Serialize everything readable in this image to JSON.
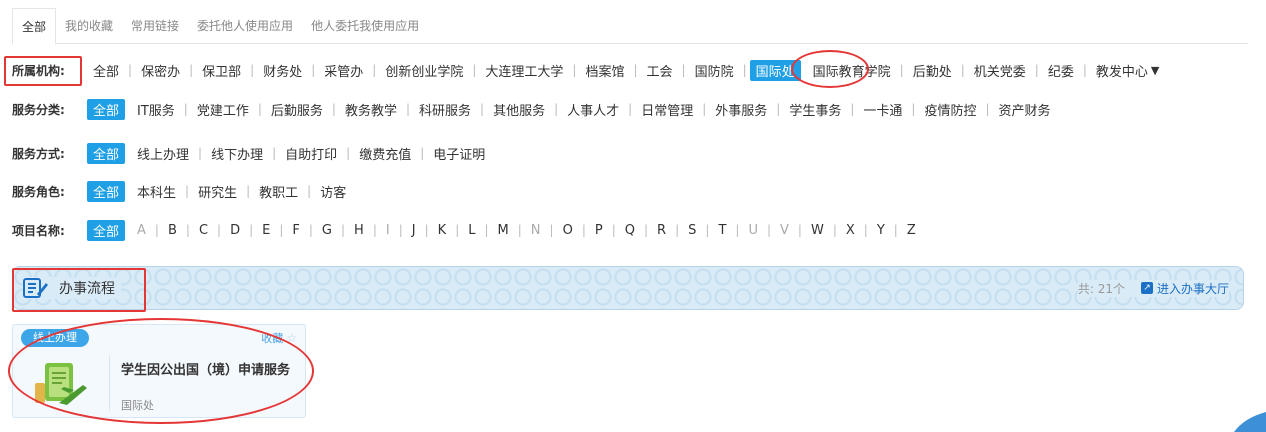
{
  "tabs": [
    "全部",
    "我的收藏",
    "常用链接",
    "委托他人使用应用",
    "他人委托我使用应用"
  ],
  "filters": {
    "org": {
      "label": "所属机构:",
      "items": [
        "全部",
        "保密办",
        "保卫部",
        "财务处",
        "采管办",
        "创新创业学院",
        "大连理工大学",
        "档案馆",
        "工会",
        "国防院",
        "国际处",
        "国际教育学院",
        "后勤处",
        "机关党委",
        "纪委",
        "教发中心"
      ],
      "selected": "国际处"
    },
    "category": {
      "label": "服务分类:",
      "items": [
        "全部",
        "IT服务",
        "党建工作",
        "后勤服务",
        "教务教学",
        "科研服务",
        "其他服务",
        "人事人才",
        "日常管理",
        "外事服务",
        "学生事务",
        "一卡通",
        "疫情防控",
        "资产财务"
      ],
      "selected": "全部"
    },
    "method": {
      "label": "服务方式:",
      "items": [
        "全部",
        "线上办理",
        "线下办理",
        "自助打印",
        "缴费充值",
        "电子证明"
      ],
      "selected": "全部"
    },
    "role": {
      "label": "服务角色:",
      "items": [
        "全部",
        "本科生",
        "研究生",
        "教职工",
        "访客"
      ],
      "selected": "全部"
    },
    "name": {
      "label": "项目名称:",
      "items": [
        "全部",
        "A",
        "B",
        "C",
        "D",
        "E",
        "F",
        "G",
        "H",
        "I",
        "J",
        "K",
        "L",
        "M",
        "N",
        "O",
        "P",
        "Q",
        "R",
        "S",
        "T",
        "U",
        "V",
        "W",
        "X",
        "Y",
        "Z"
      ],
      "disabled": [
        "A",
        "I",
        "N",
        "U",
        "V"
      ],
      "selected": "全部"
    }
  },
  "banner": {
    "title": "办事流程",
    "count": "共: 21个",
    "enter_label": "进入办事大厅"
  },
  "card": {
    "badge": "线上办理",
    "fav_label": "收藏",
    "title": "学生因公出国（境）申请服务",
    "dept": "国际处"
  },
  "colors": {
    "accent": "#1e9fe6",
    "highlight": "#e53636",
    "banner_bg": "#d9ebf7",
    "link": "#1b6fc4"
  }
}
